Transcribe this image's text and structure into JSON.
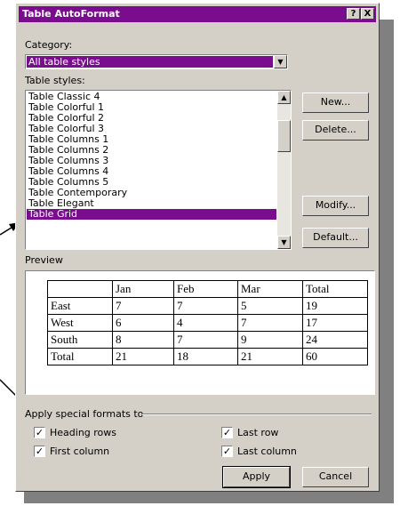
{
  "dialog": {
    "title": "Table AutoFormat",
    "help_button": "?",
    "close_button": "X",
    "category_label": "Category:",
    "category_value": "All table styles",
    "styles_label": "Table styles:",
    "styles": [
      "Table Classic 4",
      "Table Colorful 1",
      "Table Colorful 2",
      "Table Colorful 3",
      "Table Columns 1",
      "Table Columns 2",
      "Table Columns 3",
      "Table Columns 4",
      "Table Columns 5",
      "Table Contemporary",
      "Table Elegant",
      "Table Grid"
    ],
    "selected_style": "Table Grid",
    "buttons": {
      "new": "New...",
      "delete": "Delete...",
      "modify": "Modify...",
      "default": "Default...",
      "apply": "Apply",
      "cancel": "Cancel"
    },
    "preview_label": "Preview",
    "preview_table": [
      [
        "",
        "Jan",
        "Feb",
        "Mar",
        "Total"
      ],
      [
        "East",
        "7",
        "7",
        "5",
        "19"
      ],
      [
        "West",
        "6",
        "4",
        "7",
        "17"
      ],
      [
        "South",
        "8",
        "7",
        "9",
        "24"
      ],
      [
        "Total",
        "21",
        "18",
        "21",
        "60"
      ]
    ],
    "special_formats_label": "Apply special formats to",
    "options": {
      "heading_rows": {
        "label": "Heading rows",
        "checked": true
      },
      "first_column": {
        "label": "First column",
        "checked": true
      },
      "last_row": {
        "label": "Last row",
        "checked": true
      },
      "last_column": {
        "label": "Last column",
        "checked": true
      }
    },
    "accent_color": "#7a0c8e"
  }
}
